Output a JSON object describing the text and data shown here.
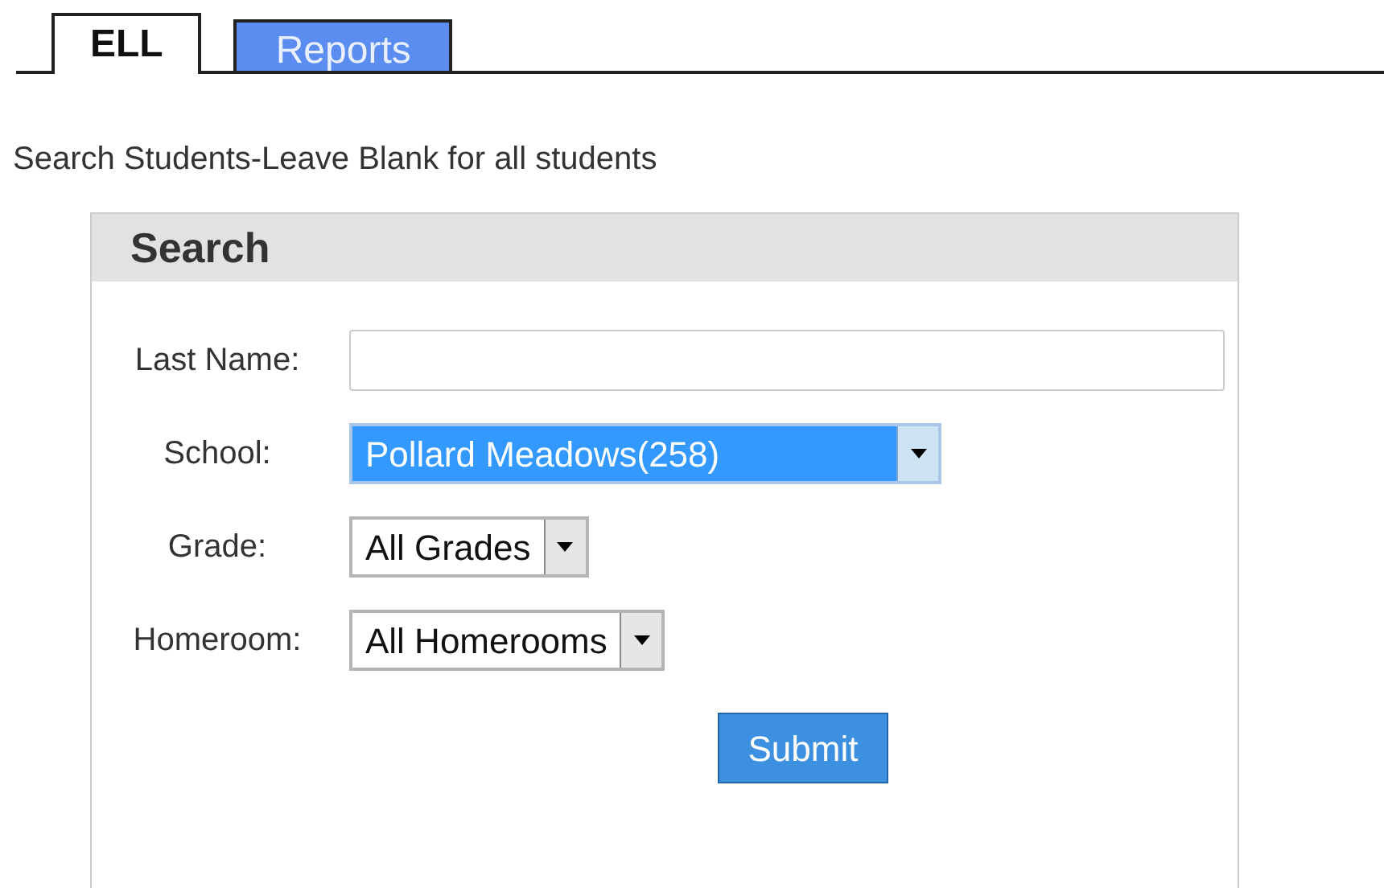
{
  "tabs": [
    {
      "label": "ELL",
      "selected": true
    },
    {
      "label": "Reports",
      "selected": false
    }
  ],
  "instructions": "Search Students-Leave Blank for all students",
  "search_panel": {
    "title": "Search",
    "fields": [
      {
        "kind": "text",
        "label": "Last Name:"
      },
      {
        "kind": "select",
        "label": "School:",
        "value": "Pollard Meadows(258)",
        "focused": true
      },
      {
        "kind": "select",
        "label": "Grade:",
        "value": "All Grades",
        "focused": false
      },
      {
        "kind": "select",
        "label": "Homeroom:",
        "value": "All Homerooms",
        "focused": false
      }
    ],
    "submit": "Submit"
  }
}
